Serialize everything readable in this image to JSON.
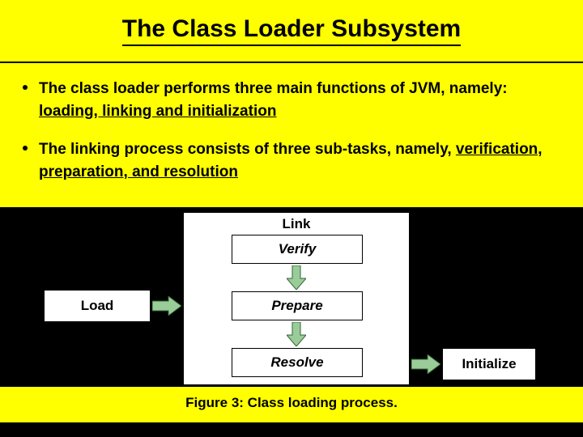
{
  "title": "The Class Loader Subsystem",
  "bullets": [
    {
      "prefix": "The class loader performs three main functions of JVM, namely: ",
      "underlined": "loading, linking and initialization"
    },
    {
      "prefix": "The linking process consists of three sub-tasks, namely, ",
      "underlined": "verification, preparation, and resolution"
    }
  ],
  "diagram": {
    "load": "Load",
    "link": "Link",
    "verify": "Verify",
    "prepare": "Prepare",
    "resolve": "Resolve",
    "initialize": "Initialize"
  },
  "caption": "Figure 3: Class loading process.",
  "colors": {
    "slide_bg": "#ffff00",
    "frame_bg": "#000000",
    "arrow_fill": "#99cc99",
    "arrow_stroke": "#336633"
  }
}
